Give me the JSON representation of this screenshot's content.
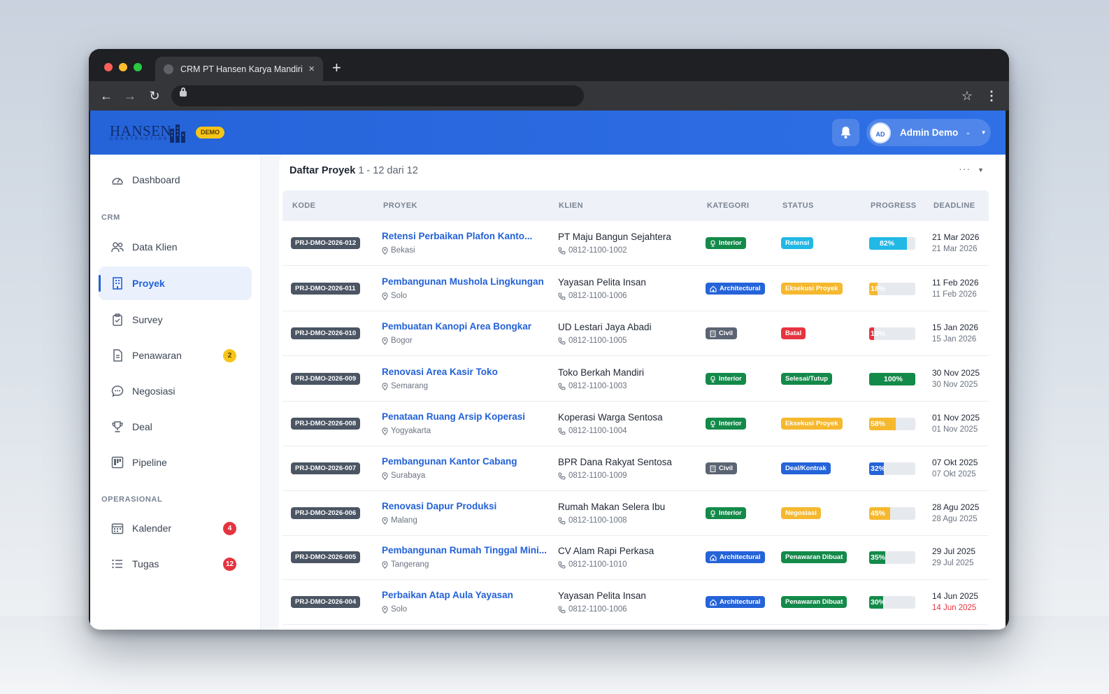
{
  "browser": {
    "tab_title": "CRM PT Hansen Karya Mandiri",
    "tab_close": "×",
    "new_tab": "+"
  },
  "header": {
    "logo_text": "HANSEN",
    "logo_sub": "CONSTRUCTION",
    "demo_badge": "DEMO",
    "user_initials": "AD",
    "user_name": "Admin Demo"
  },
  "sidebar": {
    "dashboard": "Dashboard",
    "section_crm": "CRM",
    "data_klien": "Data Klien",
    "proyek": "Proyek",
    "survey": "Survey",
    "penawaran": "Penawaran",
    "penawaran_badge": "2",
    "negosiasi": "Negosiasi",
    "deal": "Deal",
    "pipeline": "Pipeline",
    "section_operasional": "OPERASIONAL",
    "kalender": "Kalender",
    "kalender_badge": "4",
    "tugas": "Tugas",
    "tugas_badge": "12"
  },
  "main": {
    "title": "Daftar Proyek",
    "range": "1 - 12 dari 12",
    "more": "···",
    "columns": {
      "kode": "KODE",
      "proyek": "PROYEK",
      "klien": "KLIEN",
      "kategori": "KATEGORI",
      "status": "STATUS",
      "progress": "PROGRESS",
      "deadline": "DEADLINE"
    },
    "rows": [
      {
        "kode": "PRJ-DMO-2026-012",
        "proyek": "Retensi Perbaikan Plafon Kanto...",
        "lokasi": "Bekasi",
        "klien": "PT Maju Bangun Sejahtera",
        "telepon": "0812-1100-1002",
        "kategori": "Interior",
        "status": "Retensi",
        "progress": 82,
        "progress_label": "82%",
        "deadline": "21 Mar 2026",
        "deadline_sub": "21 Mar 2026"
      },
      {
        "kode": "PRJ-DMO-2026-011",
        "proyek": "Pembangunan Mushola Lingkungan",
        "lokasi": "Solo",
        "klien": "Yayasan Pelita Insan",
        "telepon": "0812-1100-1006",
        "kategori": "Architectural",
        "status": "Eksekusi Proyek",
        "progress": 18,
        "progress_label": "18%",
        "deadline": "11 Feb 2026",
        "deadline_sub": "11 Feb 2026"
      },
      {
        "kode": "PRJ-DMO-2026-010",
        "proyek": "Pembuatan Kanopi Area Bongkar",
        "lokasi": "Bogor",
        "klien": "UD Lestari Jaya Abadi",
        "telepon": "0812-1100-1005",
        "kategori": "Civil",
        "status": "Batal",
        "progress": 10,
        "progress_label": "10%",
        "deadline": "15 Jan 2026",
        "deadline_sub": "15 Jan 2026"
      },
      {
        "kode": "PRJ-DMO-2026-009",
        "proyek": "Renovasi Area Kasir Toko",
        "lokasi": "Semarang",
        "klien": "Toko Berkah Mandiri",
        "telepon": "0812-1100-1003",
        "kategori": "Interior",
        "status": "Selesai/Tutup",
        "progress": 100,
        "progress_label": "100%",
        "deadline": "30 Nov 2025",
        "deadline_sub": "30 Nov 2025"
      },
      {
        "kode": "PRJ-DMO-2026-008",
        "proyek": "Penataan Ruang Arsip Koperasi",
        "lokasi": "Yogyakarta",
        "klien": "Koperasi Warga Sentosa",
        "telepon": "0812-1100-1004",
        "kategori": "Interior",
        "status": "Eksekusi Proyek",
        "progress": 58,
        "progress_label": "58%",
        "deadline": "01 Nov 2025",
        "deadline_sub": "01 Nov 2025"
      },
      {
        "kode": "PRJ-DMO-2026-007",
        "proyek": "Pembangunan Kantor Cabang",
        "lokasi": "Surabaya",
        "klien": "BPR Dana Rakyat Sentosa",
        "telepon": "0812-1100-1009",
        "kategori": "Civil",
        "status": "Deal/Kontrak",
        "progress": 32,
        "progress_label": "32%",
        "deadline": "07 Okt 2025",
        "deadline_sub": "07 Okt 2025"
      },
      {
        "kode": "PRJ-DMO-2026-006",
        "proyek": "Renovasi Dapur Produksi",
        "lokasi": "Malang",
        "klien": "Rumah Makan Selera Ibu",
        "telepon": "0812-1100-1008",
        "kategori": "Interior",
        "status": "Negosiasi",
        "progress": 45,
        "progress_label": "45%",
        "deadline": "28 Agu 2025",
        "deadline_sub": "28 Agu 2025"
      },
      {
        "kode": "PRJ-DMO-2026-005",
        "proyek": "Pembangunan Rumah Tinggal Mini...",
        "lokasi": "Tangerang",
        "klien": "CV Alam Rapi Perkasa",
        "telepon": "0812-1100-1010",
        "kategori": "Architectural",
        "status": "Penawaran Dibuat",
        "progress": 35,
        "progress_label": "35%",
        "deadline": "29 Jul 2025",
        "deadline_sub": "29 Jul 2025"
      },
      {
        "kode": "PRJ-DMO-2026-004",
        "proyek": "Perbaikan Atap Aula Yayasan",
        "lokasi": "Solo",
        "klien": "Yayasan Pelita Insan",
        "telepon": "0812-1100-1006",
        "kategori": "Architectural",
        "status": "Penawaran Dibuat",
        "progress": 30,
        "progress_label": "30%",
        "deadline": "14 Jun 2025",
        "deadline_sub": "14 Jun 2025",
        "overdue": true
      }
    ]
  },
  "colors": {
    "primary": "#2563d9",
    "interior": "#148a4a",
    "architectural": "#2563d9",
    "civil": "#5b6472",
    "retensi": "#22b8e6",
    "eksekusi": "#f5b82e",
    "batal": "#e5343f",
    "selesai": "#148a4a",
    "deal": "#2563d9",
    "negosiasi": "#f5b82e",
    "penawaran": "#148a4a"
  }
}
